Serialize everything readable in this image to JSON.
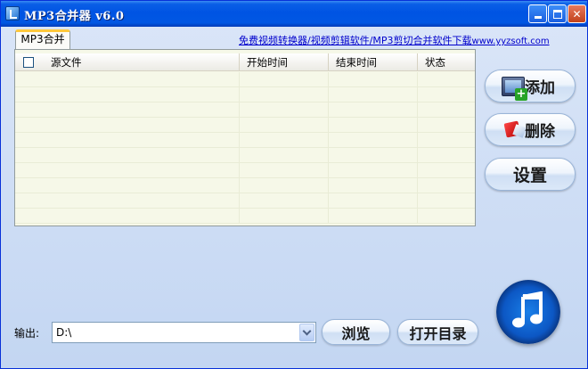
{
  "window": {
    "title": "MP3合并器 v6.0",
    "buttons": {
      "minimize": "minimize-icon",
      "maximize": "maximize-icon",
      "close": "close-icon"
    }
  },
  "tabs": [
    {
      "label": "MP3合并",
      "selected": true
    }
  ],
  "promo": {
    "link_text": "免费视频转换器/视频剪辑软件/MP3剪切合并软件下载",
    "domain": "www.yyzsoft.com"
  },
  "file_list": {
    "columns": [
      "源文件",
      "开始时间",
      "结束时间",
      "状态"
    ],
    "select_all_checked": false,
    "rows": []
  },
  "side_buttons": {
    "add": "添加",
    "delete": "删除",
    "settings": "设置"
  },
  "output": {
    "label": "输出:",
    "value": "D:\\"
  },
  "bottom_buttons": {
    "browse": "浏览",
    "open_dir": "打开目录"
  },
  "colors": {
    "title_bar": "#0054e3",
    "list_background": "#f6f8e8",
    "link": "#0000cc",
    "tab_accent": "#ffc83c"
  }
}
